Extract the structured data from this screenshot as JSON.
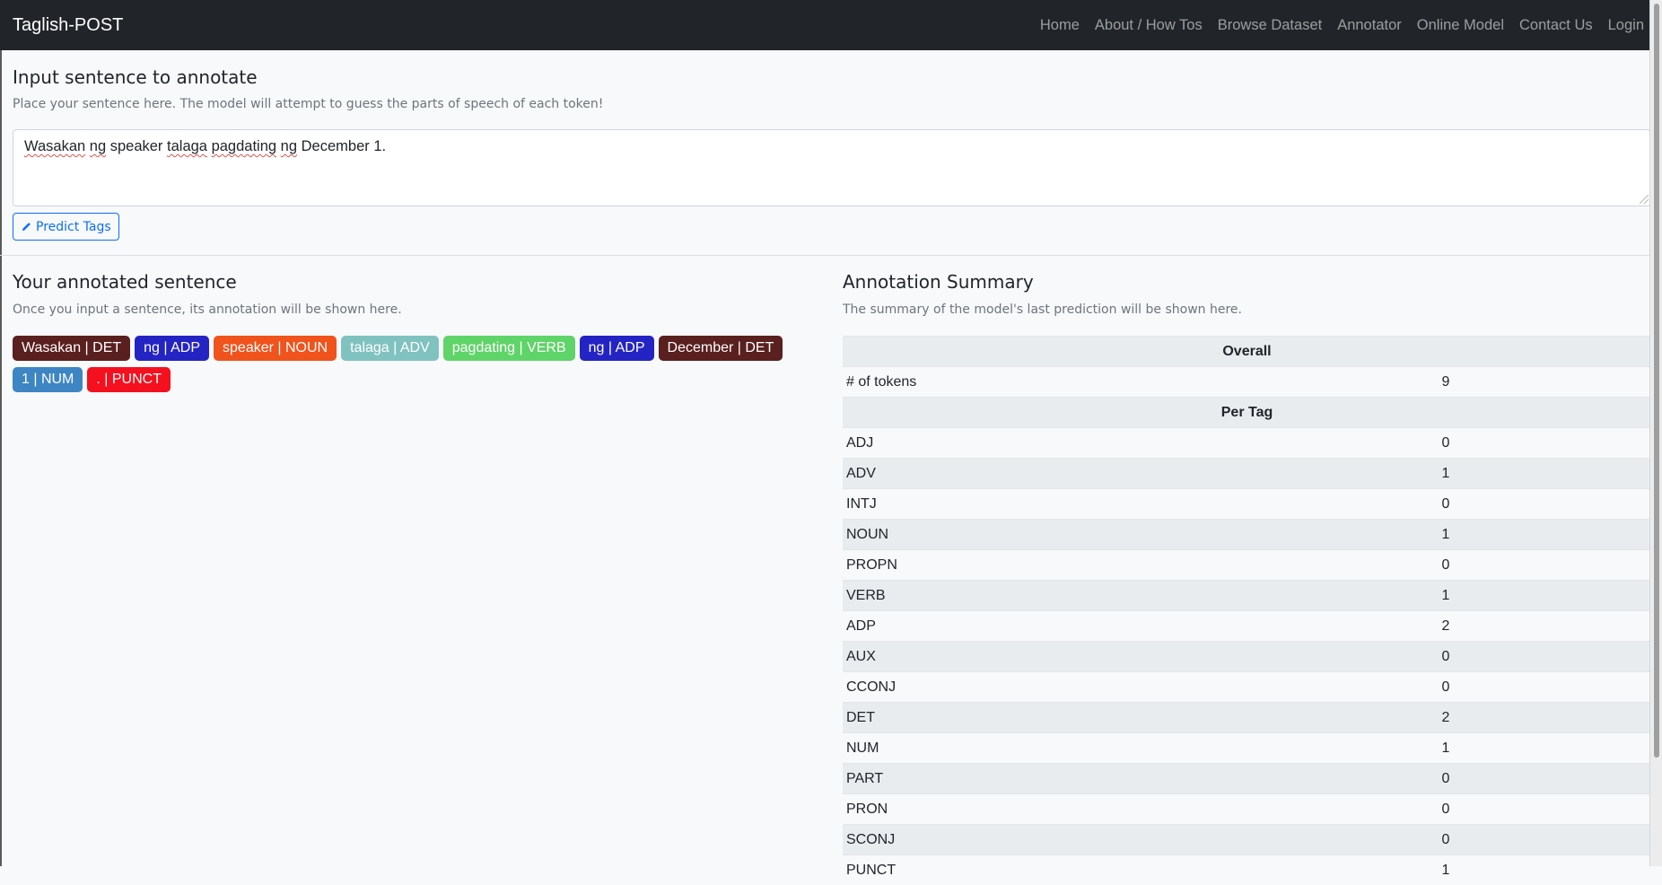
{
  "navbar": {
    "brand": "Taglish-POST",
    "links": [
      "Home",
      "About / How Tos",
      "Browse Dataset",
      "Annotator",
      "Online Model",
      "Contact Us",
      "Login"
    ]
  },
  "input_section": {
    "title": "Input sentence to annotate",
    "hint": "Place your sentence here. The model will attempt to guess the parts of speech of each token!",
    "sentence_words": [
      "Wasakan",
      "ng",
      "speaker",
      "talaga",
      "pagdating",
      "ng",
      "December",
      "1."
    ],
    "predict_button": "Predict Tags"
  },
  "annotated": {
    "title": "Your annotated sentence",
    "hint": "Once you input a sentence, its annotation will be shown here.",
    "tokens": [
      {
        "label": "Wasakan | DET",
        "color": "#5a1f1f"
      },
      {
        "label": "ng | ADP",
        "color": "#2424c4"
      },
      {
        "label": "speaker | NOUN",
        "color": "#f0531c"
      },
      {
        "label": "talaga | ADV",
        "color": "#80c2c0"
      },
      {
        "label": "pagdating | VERB",
        "color": "#5fd468"
      },
      {
        "label": "ng | ADP",
        "color": "#2424c4"
      },
      {
        "label": "December | DET",
        "color": "#5a1f1f"
      },
      {
        "label": "1 | NUM",
        "color": "#3e85c4"
      },
      {
        "label": ". | PUNCT",
        "color": "#f5101f"
      }
    ]
  },
  "summary": {
    "title": "Annotation Summary",
    "hint": "The summary of the model's last prediction will be shown here.",
    "overall_header": "Overall",
    "tokens_label": "# of tokens",
    "tokens_value": "9",
    "per_tag_header": "Per Tag",
    "rows": [
      {
        "tag": "ADJ",
        "count": "0"
      },
      {
        "tag": "ADV",
        "count": "1"
      },
      {
        "tag": "INTJ",
        "count": "0"
      },
      {
        "tag": "NOUN",
        "count": "1"
      },
      {
        "tag": "PROPN",
        "count": "0"
      },
      {
        "tag": "VERB",
        "count": "1"
      },
      {
        "tag": "ADP",
        "count": "2"
      },
      {
        "tag": "AUX",
        "count": "0"
      },
      {
        "tag": "CCONJ",
        "count": "0"
      },
      {
        "tag": "DET",
        "count": "2"
      },
      {
        "tag": "NUM",
        "count": "1"
      },
      {
        "tag": "PART",
        "count": "0"
      },
      {
        "tag": "PRON",
        "count": "0"
      },
      {
        "tag": "SCONJ",
        "count": "0"
      },
      {
        "tag": "PUNCT",
        "count": "1"
      }
    ]
  },
  "icons": {
    "predict": "pencil-icon"
  }
}
